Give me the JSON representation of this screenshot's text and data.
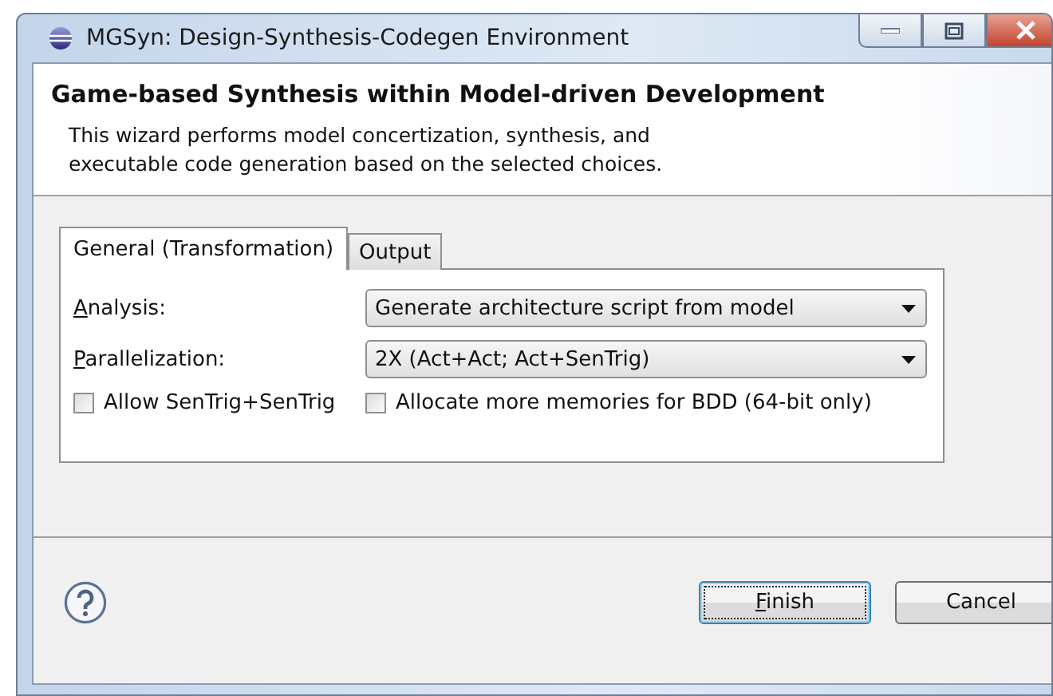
{
  "window": {
    "title": "MGSyn: Design-Synthesis-Codegen Environment"
  },
  "header": {
    "title": "Game-based Synthesis within Model-driven Development",
    "description": "This wizard performs model concertization, synthesis, and\nexecutable code generation based on the selected choices."
  },
  "tabs": [
    {
      "label": "General (Transformation)",
      "selected": true
    },
    {
      "label": "Output",
      "selected": false
    }
  ],
  "fields": [
    {
      "label": "Analysis:",
      "mnemonic_underlined": true,
      "value": "Generate architecture script from model"
    },
    {
      "label": "Parallelization:",
      "mnemonic_underlined": true,
      "value": "2X (Act+Act; Act+SenTrig)"
    }
  ],
  "options": [
    {
      "label": "Allow SenTrig+SenTrig",
      "checked": false
    },
    {
      "label": "Allocate more memories for BDD (64-bit only)",
      "checked": false
    }
  ],
  "buttons": [
    {
      "label": "Finish",
      "default": true,
      "mnemonic_underlined": true
    },
    {
      "label": "Cancel",
      "default": false,
      "mnemonic_underlined": false
    }
  ]
}
